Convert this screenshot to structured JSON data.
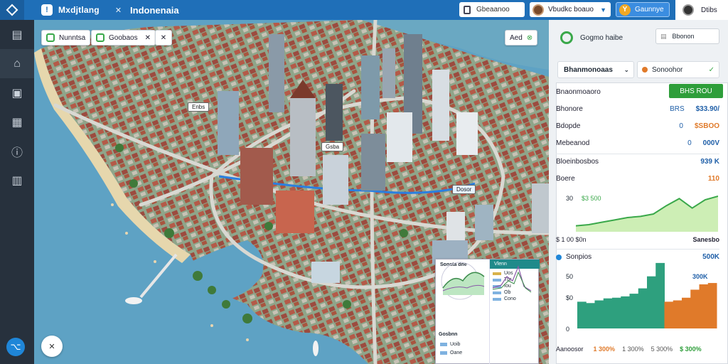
{
  "topbar": {
    "title": "Mxdjtlang",
    "close_label": "✕",
    "region": "Indonenaia",
    "search_value": "Gbeaanoo",
    "user_name": "Vbudkc boauo",
    "coins_label": "Gaunnye",
    "profile_label": "Dtibs"
  },
  "sidebar": {
    "items": [
      {
        "name": "layers-icon",
        "glyph": "▤"
      },
      {
        "name": "home-icon",
        "glyph": "⌂"
      },
      {
        "name": "building-icon",
        "glyph": "▣"
      },
      {
        "name": "calendar-icon",
        "glyph": "▦"
      },
      {
        "name": "info-icon",
        "glyph": "ⓘ"
      },
      {
        "name": "chart-icon",
        "glyph": "▥"
      }
    ],
    "fab_glyph": "⌥"
  },
  "map": {
    "btn_left": "Nunntsa",
    "btn_mid": "Goobaos",
    "btn_mid_icon": "✕",
    "btn_tools": "✕",
    "btn_right": "Aed",
    "btn_right_icon": "⊗",
    "label_a": "Enbs",
    "label_b": "Gsba",
    "label_c": "Dosor",
    "fab_glyph": "✕"
  },
  "inset": {
    "left_title": "Sonsta dne",
    "left_footer": "Gosbnn",
    "left_rows": [
      "Uoib",
      "Oane"
    ],
    "right_title": "Vlenn",
    "right_rows": [
      "Uos",
      "Tbr",
      "Iou",
      "Ob",
      "Cono"
    ]
  },
  "panel": {
    "header_title": "Gogmo haibe",
    "header_btn": "Bbonon",
    "dropdown_value": "Bhanmonoaas",
    "tag_label": "Sonoohor",
    "section_title": "Bnaonmoaoro",
    "green_btn": "BHS ROU",
    "rows": [
      {
        "label": "Bhonore",
        "tag": "BRS",
        "value": "$33.90/",
        "tag_color": "#1f5fa8",
        "val_color": "#1f5fa8"
      },
      {
        "label": "Bdopde",
        "tag": "0",
        "value": "$SBOO",
        "tag_color": "#1f5fa8",
        "val_color": "#e07a2a"
      },
      {
        "label": "Mebeanod",
        "tag": "0",
        "value": "000V",
        "tag_color": "#1f5fa8",
        "val_color": "#1f5fa8"
      }
    ],
    "chart1": {
      "title": "Bloeinbosbos",
      "value": "939 K",
      "sub": "Boere",
      "sub_value": "110",
      "ylabel_top": "$3 500",
      "ylabel_mid": "30",
      "footer_left": "$ 1 00 $0n",
      "footer_right": "Sanesbo"
    },
    "chart2": {
      "title": "Sonpios",
      "value": "500K",
      "ylabels": [
        "300K",
        "$0",
        "50",
        "0"
      ],
      "footer_label": "Aanoosor",
      "footer_values": [
        "1 300%",
        "1 300%",
        "5 300%",
        "$ 300%"
      ]
    }
  },
  "chart_data": [
    {
      "type": "area",
      "title": "Bloeinbosbos",
      "x": [
        1,
        2,
        3,
        4,
        5,
        6,
        7,
        8,
        9,
        10,
        11,
        12
      ],
      "values": [
        5,
        6,
        8,
        10,
        12,
        13,
        15,
        22,
        28,
        20,
        27,
        30
      ]
    },
    {
      "type": "bar",
      "title": "Sonpios",
      "values": [
        40,
        38,
        42,
        45,
        46,
        48,
        52,
        60,
        78,
        98,
        40,
        42,
        46,
        58,
        66,
        68
      ],
      "colors": [
        "#2ea07e",
        "#2ea07e",
        "#2ea07e",
        "#2ea07e",
        "#2ea07e",
        "#2ea07e",
        "#2ea07e",
        "#2ea07e",
        "#2ea07e",
        "#2ea07e",
        "#e07a2a",
        "#e07a2a",
        "#e07a2a",
        "#e07a2a",
        "#e07a2a",
        "#e07a2a"
      ]
    }
  ]
}
